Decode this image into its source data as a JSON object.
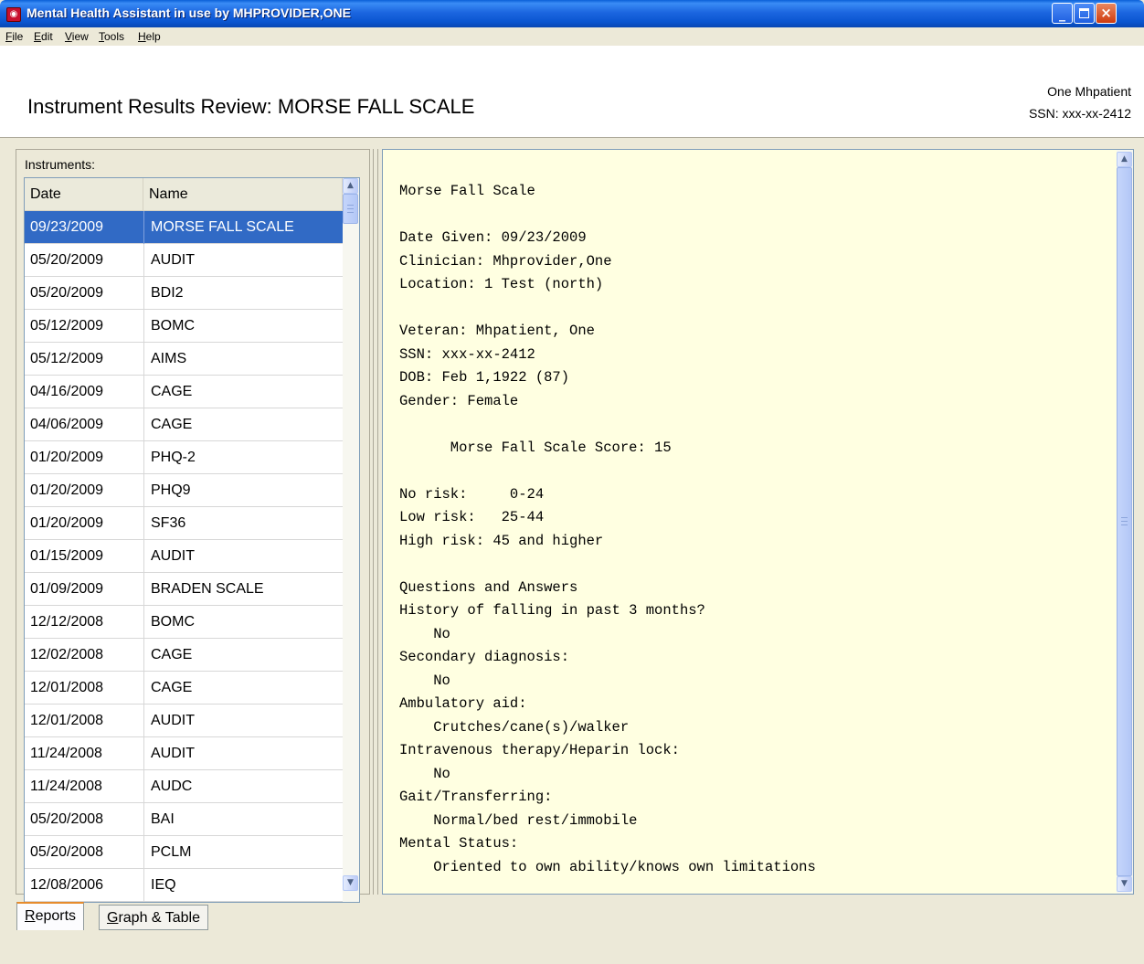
{
  "window": {
    "title": "Mental Health Assistant in use by MHPROVIDER,ONE",
    "icon": "app-icon",
    "controls": {
      "minimize": "_",
      "close": "×"
    }
  },
  "menu": [
    {
      "label": "File",
      "key": "F",
      "rest": "ile"
    },
    {
      "label": "Edit",
      "key": "E",
      "rest": "dit"
    },
    {
      "label": "View",
      "key": "V",
      "rest": "iew"
    },
    {
      "label": "Tools",
      "key": "T",
      "rest": "ools"
    },
    {
      "label": "Help",
      "key": "H",
      "rest": "elp"
    }
  ],
  "header": {
    "title": "Instrument Results Review: MORSE FALL SCALE",
    "patient_name": "One Mhpatient",
    "patient_ssn": "SSN: xxx-xx-2412"
  },
  "instruments": {
    "label": "Instruments:",
    "columns": [
      "Date",
      "Name"
    ],
    "selected_index": 0,
    "rows": [
      {
        "date": "09/23/2009",
        "name": "MORSE FALL SCALE"
      },
      {
        "date": "05/20/2009",
        "name": "AUDIT"
      },
      {
        "date": "05/20/2009",
        "name": "BDI2"
      },
      {
        "date": "05/12/2009",
        "name": "BOMC"
      },
      {
        "date": "05/12/2009",
        "name": "AIMS"
      },
      {
        "date": "04/16/2009",
        "name": "CAGE"
      },
      {
        "date": "04/06/2009",
        "name": "CAGE"
      },
      {
        "date": "01/20/2009",
        "name": "PHQ-2"
      },
      {
        "date": "01/20/2009",
        "name": "PHQ9"
      },
      {
        "date": "01/20/2009",
        "name": "SF36"
      },
      {
        "date": "01/15/2009",
        "name": "AUDIT"
      },
      {
        "date": "01/09/2009",
        "name": "BRADEN SCALE"
      },
      {
        "date": "12/12/2008",
        "name": "BOMC"
      },
      {
        "date": "12/02/2008",
        "name": "CAGE"
      },
      {
        "date": "12/01/2008",
        "name": "CAGE"
      },
      {
        "date": "12/01/2008",
        "name": "AUDIT"
      },
      {
        "date": "11/24/2008",
        "name": "AUDIT"
      },
      {
        "date": "11/24/2008",
        "name": "AUDC"
      },
      {
        "date": "05/20/2008",
        "name": "BAI"
      },
      {
        "date": "05/20/2008",
        "name": "PCLM"
      },
      {
        "date": "12/08/2006",
        "name": "IEQ"
      }
    ]
  },
  "report": {
    "lines": [
      "Morse Fall Scale",
      "",
      "Date Given: 09/23/2009",
      "Clinician: Mhprovider,One",
      "Location: 1 Test (north)",
      "",
      "Veteran: Mhpatient, One",
      "SSN: xxx-xx-2412",
      "DOB: Feb 1,1922 (87)",
      "Gender: Female",
      "",
      "      Morse Fall Scale Score: 15",
      "",
      "No risk:     0-24",
      "Low risk:   25-44",
      "High risk: 45 and higher",
      "",
      "Questions and Answers",
      "History of falling in past 3 months?",
      "    No",
      "Secondary diagnosis:",
      "    No",
      "Ambulatory aid:",
      "    Crutches/cane(s)/walker",
      "Intravenous therapy/Heparin lock:",
      "    No",
      "Gait/Transferring:",
      "    Normal/bed rest/immobile",
      "Mental Status:",
      "    Oriented to own ability/knows own limitations"
    ]
  },
  "tabs": [
    {
      "label": "Reports",
      "key": "R",
      "rest": "eports",
      "active": true
    },
    {
      "label": "Graph & Table",
      "key": "G",
      "rest": "raph & Table",
      "active": false
    }
  ],
  "colors": {
    "selection": "#316ac5",
    "report_background": "#ffffe1",
    "title_bar": "#0a55d0"
  }
}
